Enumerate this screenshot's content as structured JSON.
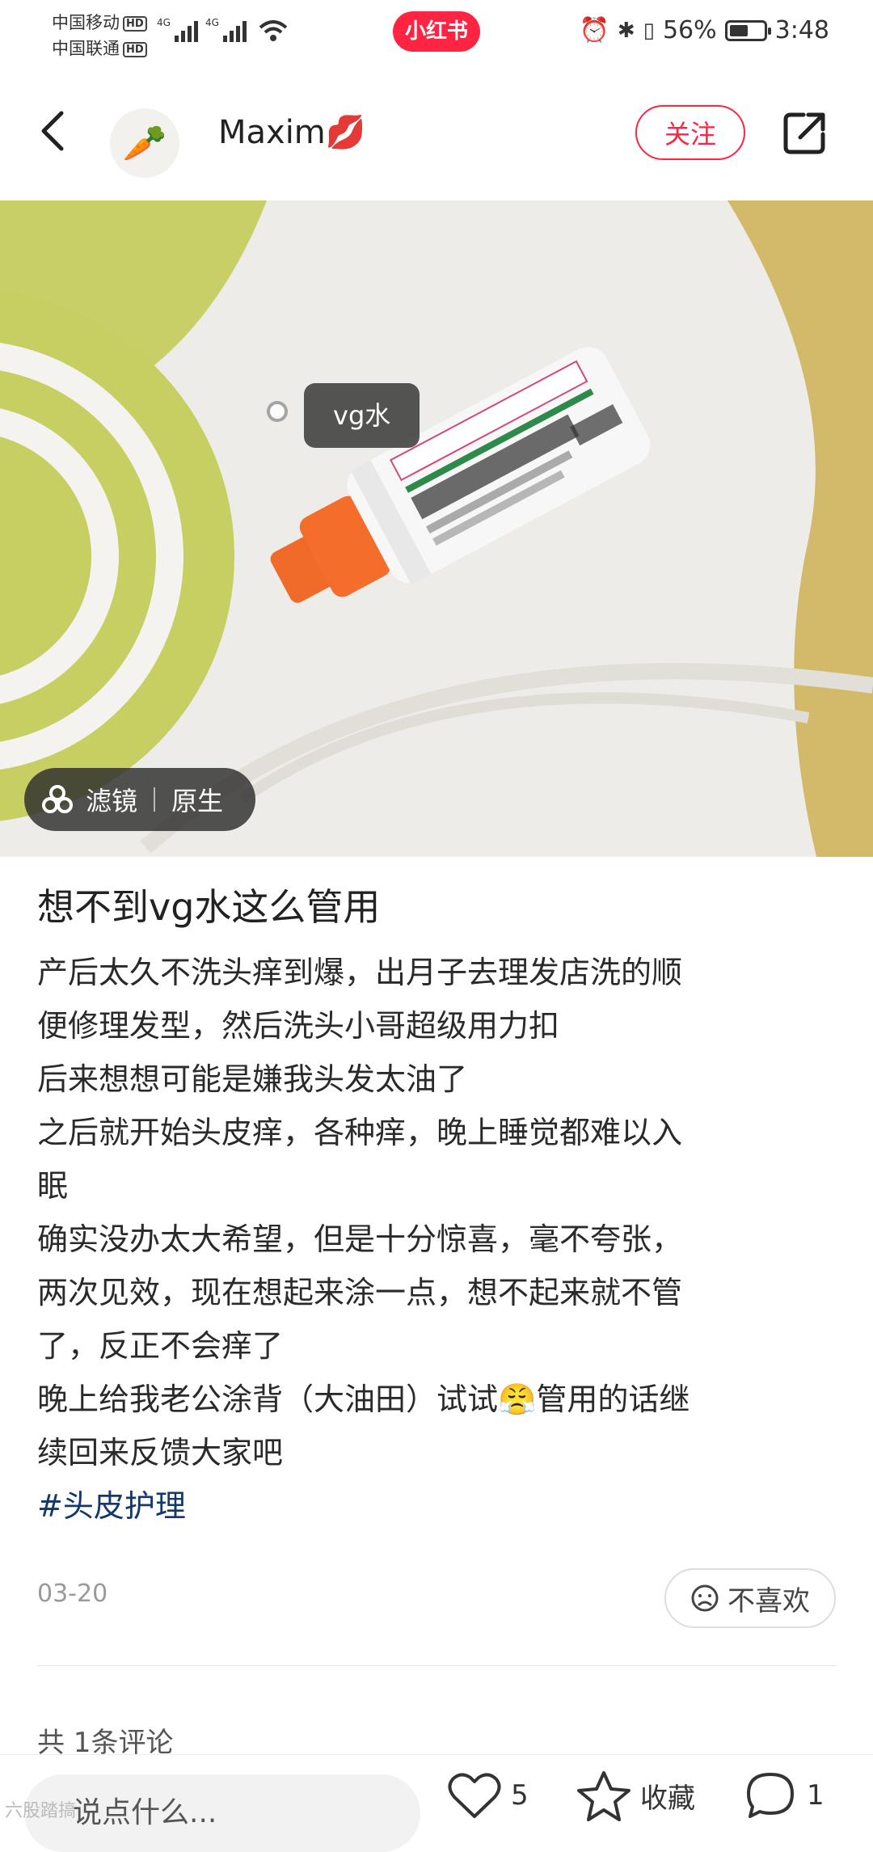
{
  "status_bar": {
    "carrier1": "中国移动",
    "carrier2": "中国联通",
    "hd": "HD",
    "net": "4G",
    "app_badge": "小红书",
    "battery_text": "56%",
    "battery_level": 0.56,
    "time": "3:48"
  },
  "header": {
    "author": "Maxim💋",
    "avatar_glyph": "🥕",
    "follow_label": "关注"
  },
  "photo": {
    "tag_label": "vg水",
    "filter_label": "滤镜",
    "filter_value": "原生"
  },
  "post": {
    "title": "想不到vg水这么管用",
    "lines": [
      "产后太久不洗头痒到爆，出月子去理发店洗的顺",
      "便修理发型，然后洗头小哥超级用力扣",
      "后来想想可能是嫌我头发太油了",
      "之后就开始头皮痒，各种痒，晚上睡觉都难以入",
      "眠",
      "确实没办太大希望，但是十分惊喜，毫不夸张，",
      "两次见效，现在想起来涂一点，想不起来就不管",
      "了，反正不会痒了",
      "晚上给我老公涂背（大油田）试试😤管用的话继",
      "续回来反馈大家吧"
    ],
    "hashtag": "#头皮护理",
    "date": "03-20",
    "dislike_label": "不喜欢",
    "comment_count": "共 1条评论"
  },
  "bottom_bar": {
    "input_placeholder": "说点什么...",
    "likes": "5",
    "collect_label": "收藏",
    "comments": "1"
  },
  "watermark": "六股踏搞"
}
